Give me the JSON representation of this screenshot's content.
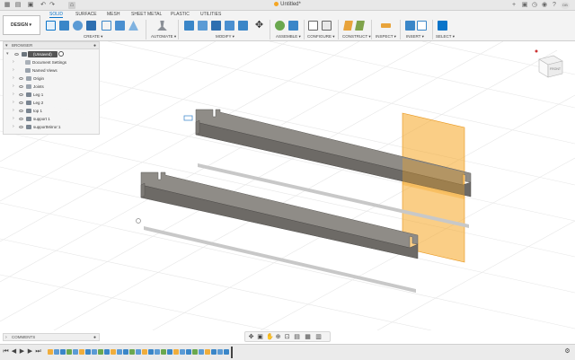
{
  "app": {
    "document_title": "Untitled*",
    "user_initials": "DB"
  },
  "toolbar": {
    "workspace_label": "DESIGN",
    "tabs": [
      "SOLID",
      "SURFACE",
      "MESH",
      "SHEET METAL",
      "PLASTIC",
      "UTILITIES"
    ],
    "active_tab": "SOLID",
    "groups": [
      "CREATE",
      "AUTOMATE",
      "MODIFY",
      "ASSEMBLE",
      "CONFIGURE",
      "CONSTRUCT",
      "INSPECT",
      "INSERT",
      "SELECT"
    ]
  },
  "browser": {
    "title": "BROWSER",
    "root_label": "(Unsaved)",
    "items": [
      "Document Settings",
      "Named Views",
      "Origin",
      "Joints",
      "Leg 1",
      "Leg 2",
      "top 1",
      "support 1",
      "supportMirror:1"
    ]
  },
  "comments": {
    "title": "COMMENTS"
  },
  "viewcube": {
    "face_label": "FRONT"
  },
  "colors": {
    "accent": "#0a74c9",
    "body_top": "#8f8c87",
    "body_side": "#6d6a66",
    "plane": "#f5a623"
  }
}
